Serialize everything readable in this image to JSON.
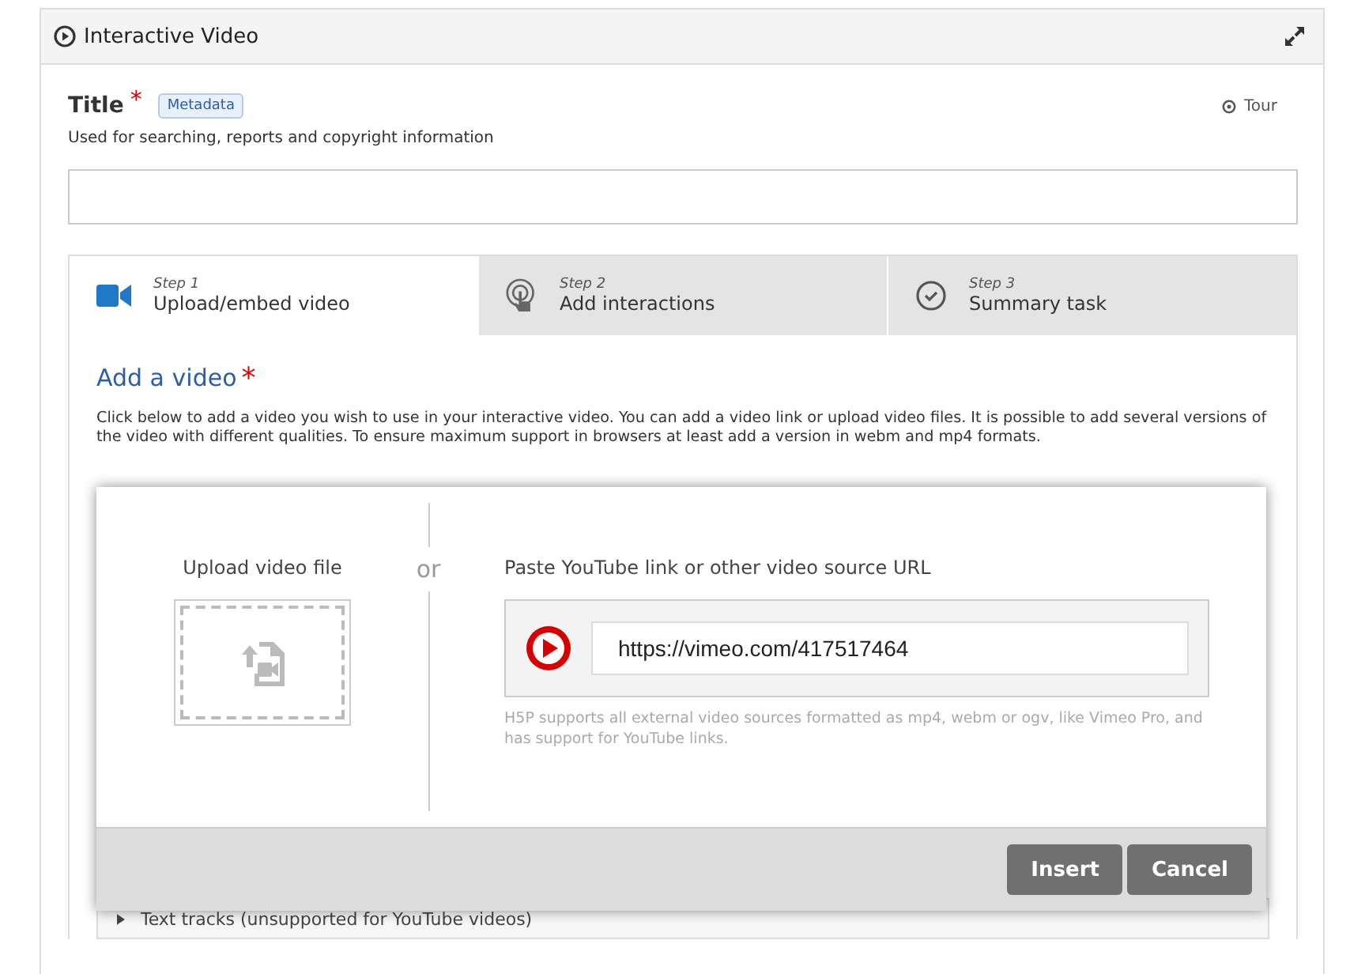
{
  "header": {
    "title": "Interactive Video"
  },
  "title_field": {
    "label": "Title",
    "required_mark": "*",
    "metadata_button": "Metadata",
    "tour": "Tour",
    "description": "Used for searching, reports and copyright information"
  },
  "steps": [
    {
      "kind": "camera",
      "step": "Step 1",
      "label": "Upload/embed video",
      "selected": true
    },
    {
      "kind": "touch",
      "step": "Step 2",
      "label": "Add interactions",
      "selected": false
    },
    {
      "kind": "check",
      "step": "Step 3",
      "label": "Summary task",
      "selected": false
    }
  ],
  "section": {
    "heading": "Add a video",
    "required_mark": "*",
    "description": "Click below to add a video you wish to use in your interactive video. You can add a video link or upload video files. It is possible to add several versions of the video with different qualities. To ensure maximum support in browsers at least add a version in webm and mp4 formats.",
    "collapsed_item": "Text tracks (unsupported for YouTube videos)"
  },
  "dialog": {
    "upload_heading": "Upload video file",
    "or": "or",
    "url_heading": "Paste YouTube link or other video source URL",
    "url_value": "https://vimeo.com/417517464",
    "url_help": "H5P supports all external video sources formatted as mp4, webm or ogv, like Vimeo Pro, and has support for YouTube links.",
    "buttons": [
      "Insert",
      "Cancel"
    ]
  }
}
